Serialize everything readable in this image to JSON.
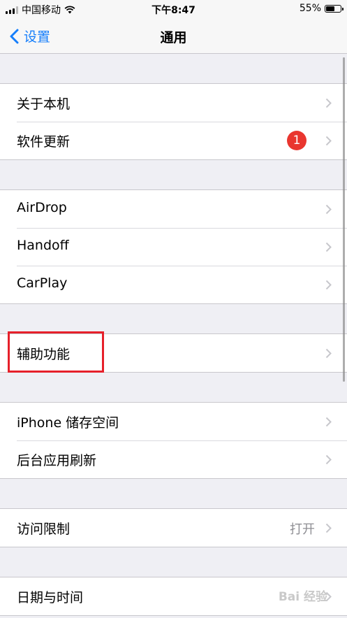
{
  "status_bar": {
    "carrier": "中国移动",
    "time": "下午8:47",
    "battery": "55%"
  },
  "nav": {
    "back_label": "设置",
    "title": "通用"
  },
  "groups": [
    {
      "rows": [
        {
          "label": "关于本机"
        },
        {
          "label": "软件更新",
          "badge": "1"
        }
      ]
    },
    {
      "rows": [
        {
          "label": "AirDrop"
        },
        {
          "label": "Handoff"
        },
        {
          "label": "CarPlay"
        }
      ]
    },
    {
      "rows": [
        {
          "label": "辅助功能"
        }
      ]
    },
    {
      "rows": [
        {
          "label": "iPhone 储存空间"
        },
        {
          "label": "后台应用刷新"
        }
      ]
    },
    {
      "rows": [
        {
          "label": "访问限制",
          "value": "打开"
        }
      ]
    },
    {
      "rows": [
        {
          "label": "日期与时间"
        }
      ]
    }
  ],
  "colors": {
    "accent": "#157efb",
    "badge": "#e9362f",
    "highlight": "#e6202a",
    "background": "#efeff4"
  },
  "watermark": "Bai 经验"
}
